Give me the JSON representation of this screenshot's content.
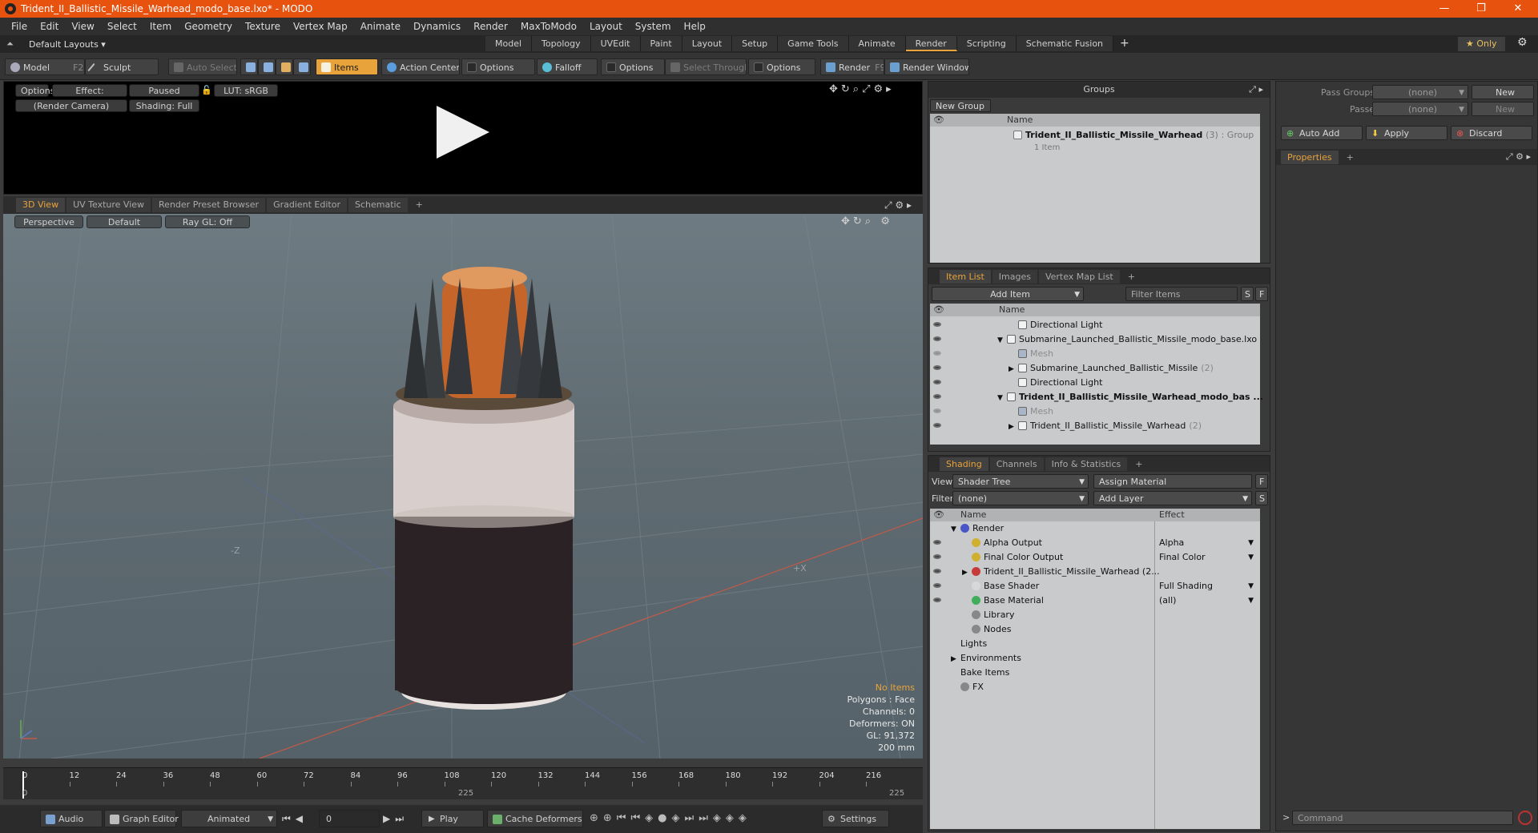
{
  "window": {
    "title": "Trident_II_Ballistic_Missile_Warhead_modo_base.lxo* - MODO"
  },
  "menu": [
    "File",
    "Edit",
    "View",
    "Select",
    "Item",
    "Geometry",
    "Texture",
    "Vertex Map",
    "Animate",
    "Dynamics",
    "Render",
    "MaxToModo",
    "Layout",
    "System",
    "Help"
  ],
  "layoutbar": {
    "layout_select": "Default Layouts ▾",
    "tabs": [
      "Model",
      "Topology",
      "UVEdit",
      "Paint",
      "Layout",
      "Setup",
      "Game Tools",
      "Animate",
      "Render",
      "Scripting",
      "Schematic Fusion"
    ],
    "active_tab": "Render",
    "add": "+",
    "only": "★  Only"
  },
  "toolbar": {
    "model": "Model",
    "model_key": "F2",
    "sculpt": "Sculpt",
    "auto_select": "Auto Select",
    "items": "Items",
    "action_center": "Action Center",
    "options1": "Options",
    "falloff": "Falloff",
    "options2": "Options",
    "select_through": "Select Through",
    "options3": "Options",
    "render": "Render",
    "render_key": "F9",
    "render_window": "Render Window"
  },
  "render_preview": {
    "options": "Options",
    "effect": "Effect: (Shadi...",
    "paused": "Paused",
    "lut": "LUT: sRGB",
    "camera": "(Render Camera)",
    "shading": "Shading: Full"
  },
  "viewport_tabs": [
    "3D View",
    "UV Texture View",
    "Render Preset Browser",
    "Gradient Editor",
    "Schematic",
    "+"
  ],
  "viewport": {
    "perspective": "Perspective",
    "default": "Default",
    "raygl": "Ray GL: Off",
    "axis_z": "-Z",
    "axis_x": "+X",
    "stats": {
      "no_items": "No Items",
      "polygons": "Polygons : Face",
      "channels": "Channels: 0",
      "deformers": "Deformers: ON",
      "gl": "GL: 91,372",
      "size": "200 mm"
    },
    "colors": {
      "orange_tank": "#c5652a",
      "white_band": "#d8cfcc",
      "black_body": "#2a2224",
      "cone": "#3a3d40"
    }
  },
  "timeline": {
    "ticks": [
      "0",
      "12",
      "24",
      "36",
      "48",
      "60",
      "72",
      "84",
      "96",
      "108",
      "120",
      "132",
      "144",
      "156",
      "168",
      "180",
      "192",
      "204",
      "216"
    ],
    "start": "0",
    "mid": "225",
    "end": "225",
    "cursor": 0
  },
  "bottombar": {
    "audio": "Audio",
    "graph_editor": "Graph Editor",
    "animated": "Animated",
    "frame": "0",
    "play": "Play",
    "cache_deformers": "Cache Deformers",
    "settings": "Settings"
  },
  "groups": {
    "title": "Groups",
    "new_group": "New Group",
    "col_name": "Name",
    "row_name": "Trident_II_Ballistic_Missile_Warhead",
    "row_count": "(3)",
    "row_type": ": Group",
    "row_sub": "1 Item"
  },
  "itemlist": {
    "tabs": [
      "Item List",
      "Images",
      "Vertex Map List",
      "+"
    ],
    "add_item": "Add Item",
    "filter": "Filter Items",
    "s": "S",
    "f": "F",
    "col_name": "Name",
    "rows": [
      {
        "label": "Directional Light",
        "indent": 1,
        "bold": false,
        "dim": false,
        "count": "",
        "arrow": ""
      },
      {
        "label": "Submarine_Launched_Ballistic_Missile_modo_base.lxo",
        "indent": 0,
        "bold": false,
        "dim": false,
        "count": "",
        "arrow": "▼"
      },
      {
        "label": "Mesh",
        "indent": 1,
        "bold": false,
        "dim": true,
        "count": "",
        "arrow": ""
      },
      {
        "label": "Submarine_Launched_Ballistic_Missile",
        "indent": 1,
        "bold": false,
        "dim": false,
        "count": "(2)",
        "arrow": "▶"
      },
      {
        "label": "Directional Light",
        "indent": 1,
        "bold": false,
        "dim": false,
        "count": "",
        "arrow": ""
      },
      {
        "label": "Trident_II_Ballistic_Missile_Warhead_modo_bas ...",
        "indent": 0,
        "bold": true,
        "dim": false,
        "count": "",
        "arrow": "▼"
      },
      {
        "label": "Mesh",
        "indent": 1,
        "bold": false,
        "dim": true,
        "count": "",
        "arrow": ""
      },
      {
        "label": "Trident_II_Ballistic_Missile_Warhead",
        "indent": 1,
        "bold": false,
        "dim": false,
        "count": "(2)",
        "arrow": "▶"
      }
    ]
  },
  "shading": {
    "tabs": [
      "Shading",
      "Channels",
      "Info & Statistics",
      "+"
    ],
    "view_label": "View",
    "view_value": "Shader Tree",
    "assign_material": "Assign Material",
    "f": "F",
    "filter_label": "Filter",
    "filter_value": "(none)",
    "add_layer": "Add Layer",
    "s": "S",
    "col_name": "Name",
    "col_effect": "Effect",
    "rows": [
      {
        "label": "Render",
        "effect": "",
        "indent": 0,
        "arrow": "▼",
        "color": "#4a56c8"
      },
      {
        "label": "Alpha Output",
        "effect": "Alpha",
        "indent": 1,
        "arrow": "",
        "color": "#d0b030"
      },
      {
        "label": "Final Color Output",
        "effect": "Final Color",
        "indent": 1,
        "arrow": "",
        "color": "#d0b030"
      },
      {
        "label": "Trident_II_Ballistic_Missile_Warhead (2...",
        "effect": "",
        "indent": 1,
        "arrow": "▶",
        "color": "#c83a3a"
      },
      {
        "label": "Base Shader",
        "effect": "Full Shading",
        "indent": 1,
        "arrow": "",
        "color": "#d8d8d8"
      },
      {
        "label": "Base Material",
        "effect": "(all)",
        "indent": 1,
        "arrow": "",
        "color": "#3fae5a"
      },
      {
        "label": "Library",
        "effect": "",
        "indent": 1,
        "arrow": "",
        "color": "#888888"
      },
      {
        "label": "Nodes",
        "effect": "",
        "indent": 1,
        "arrow": "",
        "color": "#888888"
      },
      {
        "label": "Lights",
        "effect": "",
        "indent": 0,
        "arrow": "",
        "color": ""
      },
      {
        "label": "Environments",
        "effect": "",
        "indent": 0,
        "arrow": "▶",
        "color": ""
      },
      {
        "label": "Bake Items",
        "effect": "",
        "indent": 0,
        "arrow": "",
        "color": ""
      },
      {
        "label": "FX",
        "effect": "",
        "indent": 0,
        "arrow": "",
        "color": "#888888"
      }
    ]
  },
  "right_panel": {
    "pass_groups": "Pass Groups",
    "passes": "Passes",
    "none": "(none)",
    "new": "New",
    "auto_add": "Auto Add",
    "apply": "Apply",
    "discard": "Discard",
    "properties": "Properties",
    "add": "+",
    "command": "Command"
  }
}
